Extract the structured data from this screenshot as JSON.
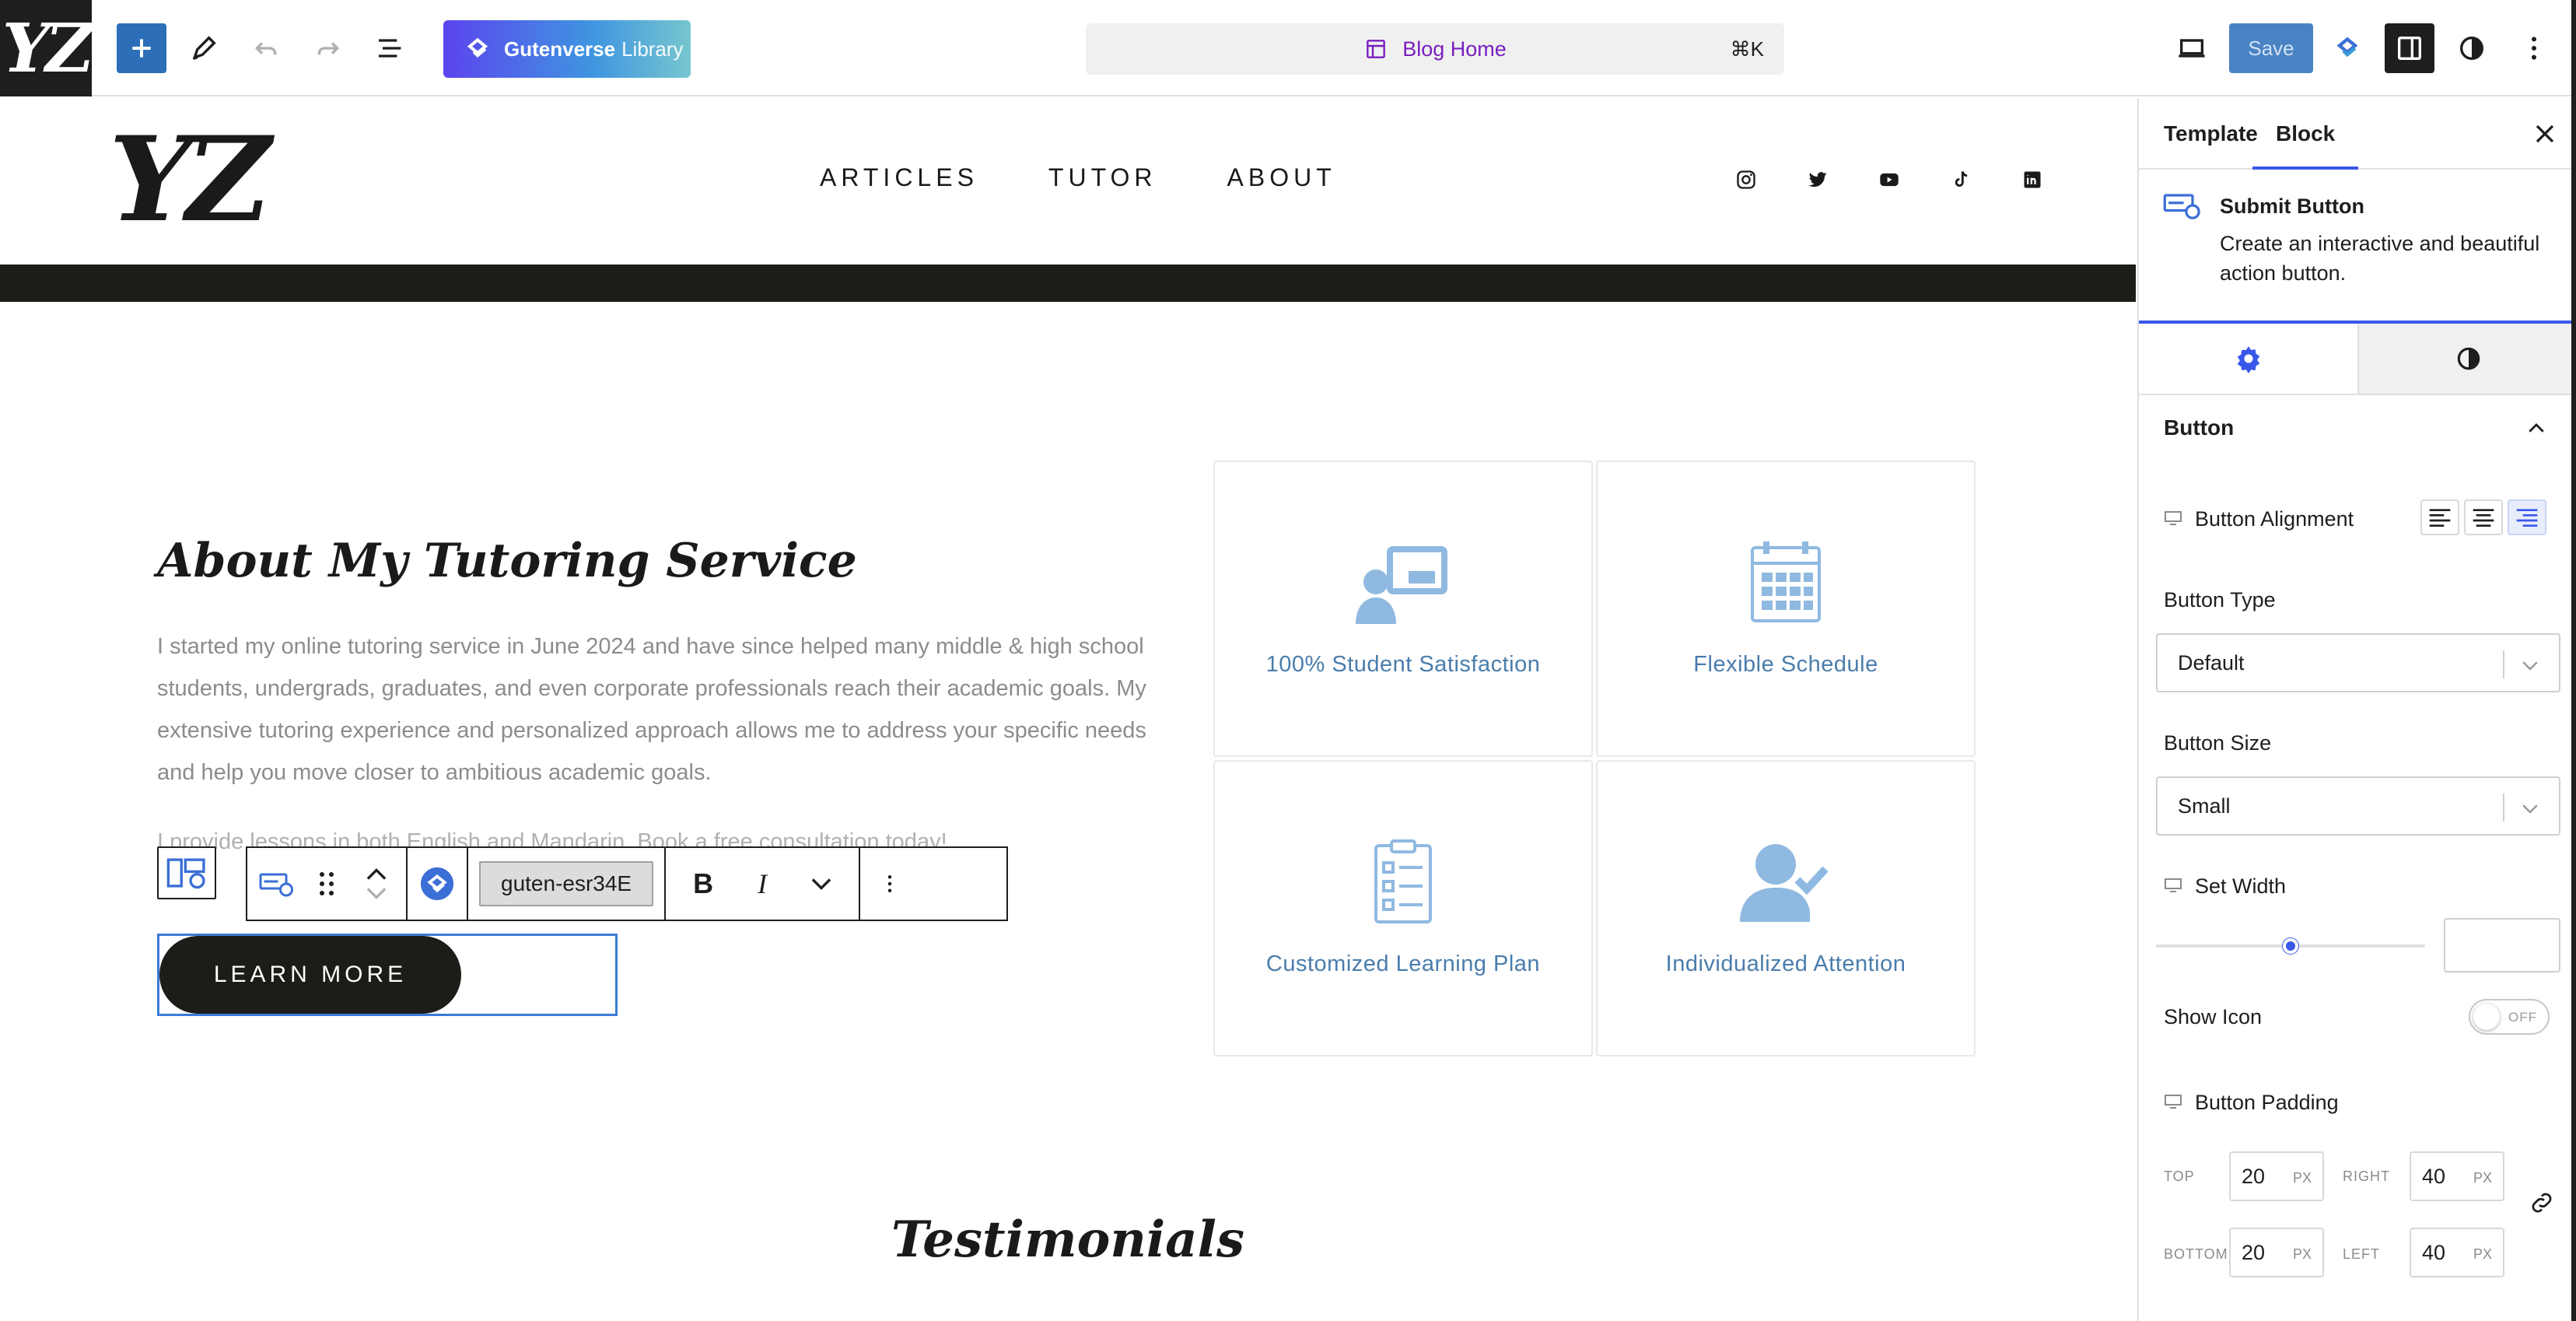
{
  "topbar": {
    "site_icon_text": "YZ",
    "library_label_bold": "Gutenverse",
    "library_label_thin": "Library",
    "document_title": "Blog Home",
    "shortcut": "⌘K",
    "save_label": "Save"
  },
  "site": {
    "logo": "YZ",
    "nav": [
      "ARTICLES",
      "TUTOR",
      "ABOUT"
    ],
    "social_icons": [
      "instagram-icon",
      "twitter-icon",
      "youtube-icon",
      "tiktok-icon",
      "linkedin-icon"
    ]
  },
  "about": {
    "title": "About My Tutoring Service",
    "text": "I started my online tutoring service in June 2024 and have since helped many middle & high school students, undergrads, graduates, and even corporate professionals reach their academic goals. My extensive tutoring experience and personalized approach allows me to address your specific needs and help you move closer to ambitious academic goals.",
    "cta_text": "I provide lessons in both English and Mandarin. Book a free consultation today!",
    "button_label": "LEARN MORE"
  },
  "block_toolbar": {
    "element_id": "guten-esr34E",
    "bold": "B",
    "italic": "I"
  },
  "features": [
    {
      "label": "100% Student Satisfaction",
      "icon": "teacher-board-icon"
    },
    {
      "label": "Flexible Schedule",
      "icon": "calendar-icon"
    },
    {
      "label": "Customized Learning Plan",
      "icon": "clipboard-list-icon"
    },
    {
      "label": "Individualized Attention",
      "icon": "user-check-icon"
    }
  ],
  "testimonials_title": "Testimonials",
  "sidebar": {
    "tabs": [
      "Template",
      "Block"
    ],
    "active_tab": "Block",
    "block_name": "Submit Button",
    "block_desc": "Create an interactive and beautiful action button.",
    "section_title": "Button",
    "button_alignment_label": "Button Alignment",
    "button_alignment_value": "right",
    "button_type_label": "Button Type",
    "button_type_value": "Default",
    "button_size_label": "Button Size",
    "button_size_value": "Small",
    "set_width_label": "Set Width",
    "set_width_slider_fraction": 0.5,
    "show_icon_label": "Show Icon",
    "show_icon_state": "OFF",
    "padding_label": "Button Padding",
    "padding": {
      "top_label": "TOP",
      "top": "20",
      "right_label": "RIGHT",
      "right": "40",
      "bottom_label": "BOTTOM",
      "bottom": "20",
      "left_label": "LEFT",
      "left": "40",
      "unit": "PX"
    }
  },
  "colors": {
    "accent": "#3858e9",
    "feature_icon": "#8fb9e0",
    "feature_text": "#4a7dac",
    "dark": "#1c1c18"
  }
}
